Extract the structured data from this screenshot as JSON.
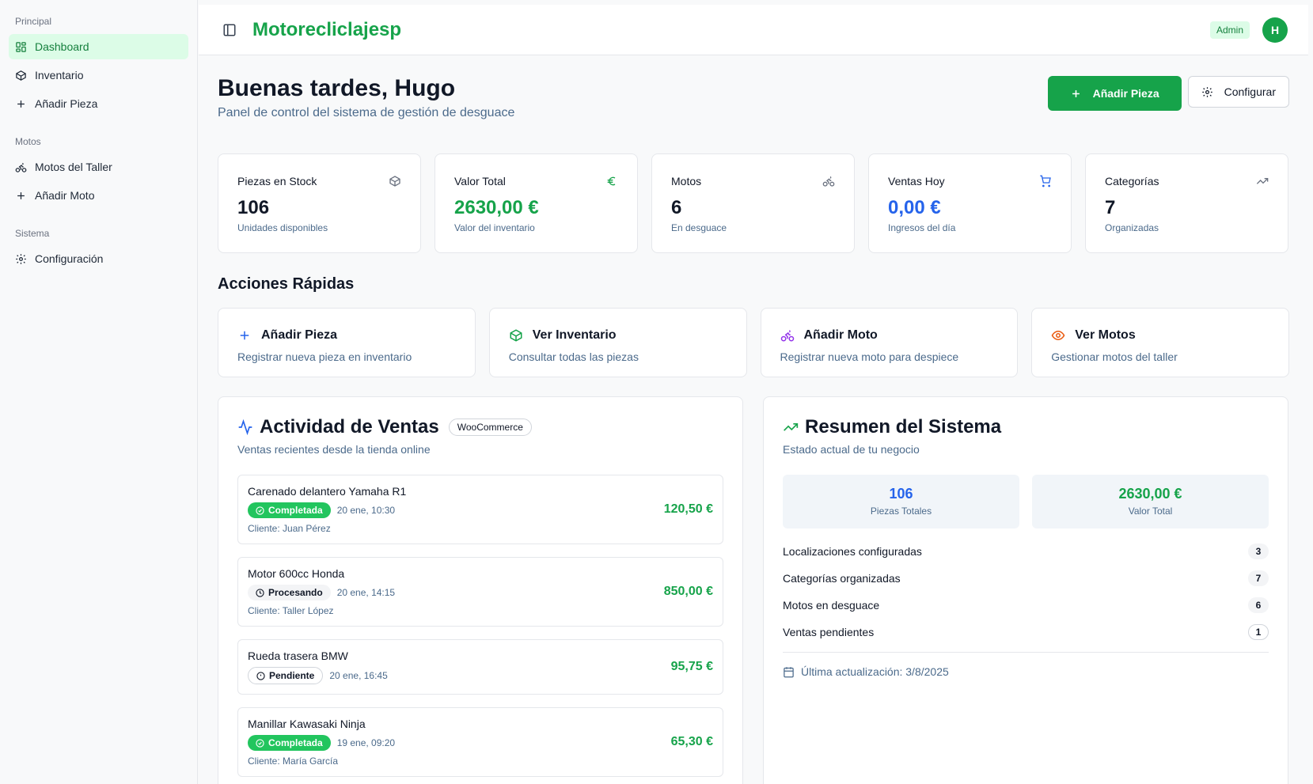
{
  "sidebar": {
    "groups": [
      {
        "label": "Principal",
        "items": [
          {
            "label": "Dashboard",
            "icon": "grid-icon"
          },
          {
            "label": "Inventario",
            "icon": "box-icon"
          },
          {
            "label": "Añadir Pieza",
            "icon": "plus-icon"
          }
        ]
      },
      {
        "label": "Motos",
        "items": [
          {
            "label": "Motos del Taller",
            "icon": "bike-icon"
          },
          {
            "label": "Añadir Moto",
            "icon": "plus-icon"
          }
        ]
      },
      {
        "label": "Sistema",
        "items": [
          {
            "label": "Configuración",
            "icon": "gear-icon"
          }
        ]
      }
    ]
  },
  "header": {
    "brand": "Motorecliclajesp",
    "role": "Admin",
    "avatar_initial": "H"
  },
  "greeting": {
    "title": "Buenas tardes, Hugo",
    "subtitle": "Panel de control del sistema de gestión de desguace",
    "add_button": "Añadir Pieza",
    "config_button": "Configurar"
  },
  "stats": [
    {
      "label": "Piezas en Stock",
      "value": "106",
      "sub": "Unidades disponibles",
      "icon": "box-icon",
      "color": "#111827"
    },
    {
      "label": "Valor Total",
      "value": "2630,00 €",
      "sub": "Valor del inventario",
      "icon": "euro-icon",
      "color": "#16a34a"
    },
    {
      "label": "Motos",
      "value": "6",
      "sub": "En desguace",
      "icon": "bike-icon",
      "color": "#111827"
    },
    {
      "label": "Ventas Hoy",
      "value": "0,00 €",
      "sub": "Ingresos del día",
      "icon": "cart-icon",
      "color": "#2563eb"
    },
    {
      "label": "Categorías",
      "value": "7",
      "sub": "Organizadas",
      "icon": "trend-icon",
      "color": "#111827"
    }
  ],
  "quick_actions": {
    "title": "Acciones Rápidas",
    "items": [
      {
        "title": "Añadir Pieza",
        "sub": "Registrar nueva pieza en inventario",
        "icon": "plus-icon",
        "color": "#2563eb"
      },
      {
        "title": "Ver Inventario",
        "sub": "Consultar todas las piezas",
        "icon": "box-icon",
        "color": "#16a34a"
      },
      {
        "title": "Añadir Moto",
        "sub": "Registrar nueva moto para despiece",
        "icon": "bike-icon",
        "color": "#9333ea"
      },
      {
        "title": "Ver Motos",
        "sub": "Gestionar motos del taller",
        "icon": "eye-icon",
        "color": "#ea580c"
      }
    ]
  },
  "sales_panel": {
    "title": "Actividad de Ventas",
    "badge": "WooCommerce",
    "subtitle": "Ventas recientes desde la tienda online",
    "sales": [
      {
        "name": "Carenado delantero Yamaha R1",
        "status": "Completada",
        "date": "20 ene, 10:30",
        "client": "Cliente: Juan Pérez",
        "amount": "120,50 €"
      },
      {
        "name": "Motor 600cc Honda",
        "status": "Procesando",
        "date": "20 ene, 14:15",
        "client": "Cliente: Taller López",
        "amount": "850,00 €"
      },
      {
        "name": "Rueda trasera BMW",
        "status": "Pendiente",
        "date": "20 ene, 16:45",
        "client": "",
        "amount": "95,75 €"
      },
      {
        "name": "Manillar Kawasaki Ninja",
        "status": "Completada",
        "date": "19 ene, 09:20",
        "client": "Cliente: María García",
        "amount": "65,30 €"
      }
    ]
  },
  "summary_panel": {
    "title": "Resumen del Sistema",
    "subtitle": "Estado actual de tu negocio",
    "tiles": [
      {
        "value": "106",
        "label": "Piezas Totales",
        "color": "#2563eb"
      },
      {
        "value": "2630,00 €",
        "label": "Valor Total",
        "color": "#16a34a"
      }
    ],
    "rows": [
      {
        "label": "Localizaciones configuradas",
        "count": "3"
      },
      {
        "label": "Categorías organizadas",
        "count": "7"
      },
      {
        "label": "Motos en desguace",
        "count": "6"
      },
      {
        "label": "Ventas pendientes",
        "count": "1"
      }
    ],
    "updated": "Última actualización: 3/8/2025"
  }
}
